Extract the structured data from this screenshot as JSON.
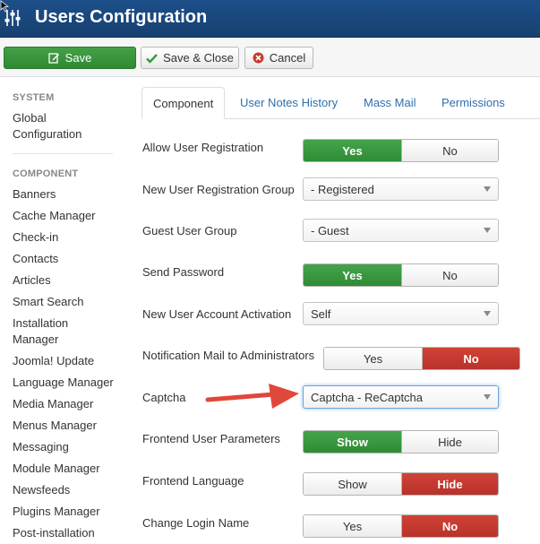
{
  "header": {
    "title": "Users Configuration",
    "icon": "settings-sliders-icon"
  },
  "toolbar": {
    "save_label": "Save",
    "save_close_label": "Save & Close",
    "cancel_label": "Cancel"
  },
  "sidebar": {
    "system_heading": "SYSTEM",
    "system_items": [
      "Global Configuration"
    ],
    "component_heading": "COMPONENT",
    "component_items": [
      "Banners",
      "Cache Manager",
      "Check-in",
      "Contacts",
      "Articles",
      "Smart Search",
      "Installation Manager",
      "Joomla! Update",
      "Language Manager",
      "Media Manager",
      "Menus Manager",
      "Messaging",
      "Module Manager",
      "Newsfeeds",
      "Plugins Manager",
      "Post-installation"
    ]
  },
  "tabs": [
    {
      "label": "Component",
      "active": true
    },
    {
      "label": "User Notes History",
      "active": false
    },
    {
      "label": "Mass Mail",
      "active": false
    },
    {
      "label": "Permissions",
      "active": false
    }
  ],
  "form": {
    "allow_registration": {
      "label": "Allow User Registration",
      "options": [
        "Yes",
        "No"
      ],
      "selected": "Yes"
    },
    "new_user_group": {
      "label": "New User Registration Group",
      "value": "- Registered"
    },
    "guest_group": {
      "label": "Guest User Group",
      "value": "- Guest"
    },
    "send_password": {
      "label": "Send Password",
      "options": [
        "Yes",
        "No"
      ],
      "selected": "Yes"
    },
    "activation": {
      "label": "New User Account Activation",
      "value": "Self"
    },
    "notify_admins": {
      "label": "Notification Mail to Administrators",
      "options": [
        "Yes",
        "No"
      ],
      "selected": "No"
    },
    "captcha": {
      "label": "Captcha",
      "value": "Captcha - ReCaptcha"
    },
    "frontend_params": {
      "label": "Frontend User Parameters",
      "options": [
        "Show",
        "Hide"
      ],
      "selected": "Show"
    },
    "frontend_language": {
      "label": "Frontend Language",
      "options": [
        "Show",
        "Hide"
      ],
      "selected": "Hide"
    },
    "change_login": {
      "label": "Change Login Name",
      "options": [
        "Yes",
        "No"
      ],
      "selected": "No"
    }
  },
  "colors": {
    "header_bg": "#1d4f8a",
    "green": "#3a9a3f",
    "red": "#c63a2f",
    "link": "#2f6fad",
    "arrow": "#e0473b"
  }
}
